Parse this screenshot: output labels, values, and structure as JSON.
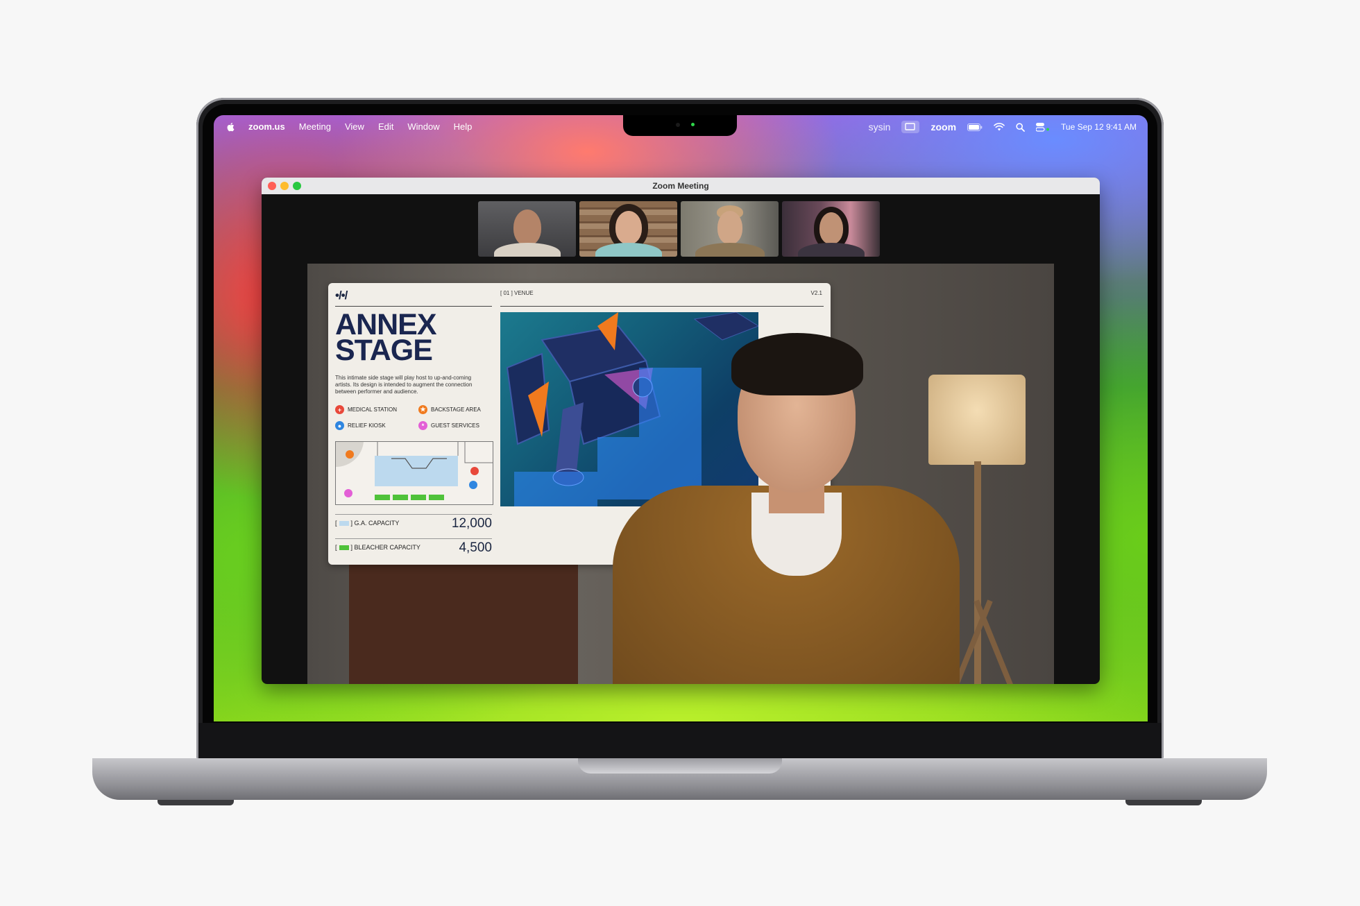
{
  "menubar": {
    "app_name": "zoom.us",
    "menus": [
      "Meeting",
      "View",
      "Edit",
      "Window",
      "Help"
    ],
    "status_user": "sysin",
    "status_app": "zoom",
    "datetime": "Tue Sep 12  9:41 AM"
  },
  "window": {
    "title": "Zoom Meeting"
  },
  "slide": {
    "logo": "•/•/",
    "section": "[ 01 ] VENUE",
    "version": "V2.1",
    "title_line1": "ANNEX",
    "title_line2": "STAGE",
    "description": "This intimate side stage will play host to up-and-coming artists. Its design is intended to augment the connection between performer and audience.",
    "legend": [
      {
        "label": "MEDICAL STATION",
        "color": "#e8483a",
        "icon": "plus-icon"
      },
      {
        "label": "BACKSTAGE AREA",
        "color": "#f07a1e",
        "icon": "star-icon"
      },
      {
        "label": "RELIEF KIOSK",
        "color": "#2f86e0",
        "icon": "drop-icon"
      },
      {
        "label": "GUEST SERVICES",
        "color": "#e35fd6",
        "icon": "asterisk-icon"
      }
    ],
    "capacities": [
      {
        "label": "G.A. CAPACITY",
        "value": "12,000",
        "swatch": "#bcd9ee"
      },
      {
        "label": "BLEACHER CAPACITY",
        "value": "4,500",
        "swatch": "#4fc23a"
      }
    ]
  },
  "colors": {
    "close": "#ff5f57",
    "minimize": "#febc2e",
    "zoom": "#28c840"
  }
}
